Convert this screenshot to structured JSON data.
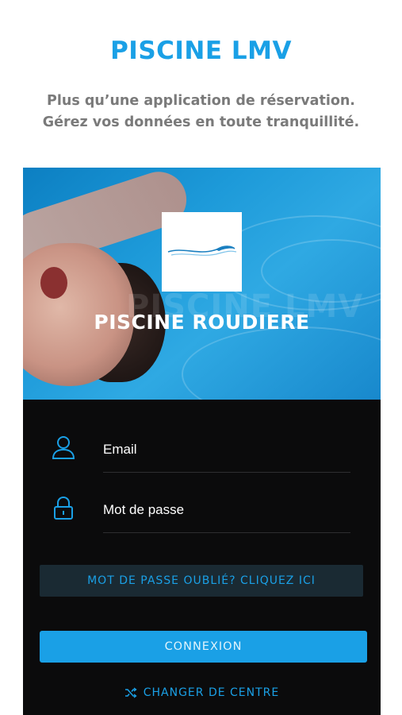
{
  "header": {
    "app_title": "PISCINE LMV",
    "tagline_line1": "Plus qu’une application de réservation.",
    "tagline_line2": "Gérez vos données en toute tranquillité."
  },
  "hero": {
    "center_name": "PISCINE ROUDIERE",
    "watermark_text": "PISCINE LMV",
    "logo_icon": "wave-logo-icon"
  },
  "form": {
    "email_label": "Email",
    "email_icon": "user-icon",
    "password_label": "Mot de passe",
    "password_icon": "lock-icon",
    "forgot_label": "MOT DE PASSE OUBLIÉ? CLIQUEZ ICI",
    "login_label": "CONNEXION",
    "change_center_label": "CHANGER DE CENTRE",
    "change_center_icon": "shuffle-icon"
  },
  "colors": {
    "accent": "#1aa0e6",
    "card_background": "#0b0b0c",
    "tagline": "#7a7a7a"
  }
}
